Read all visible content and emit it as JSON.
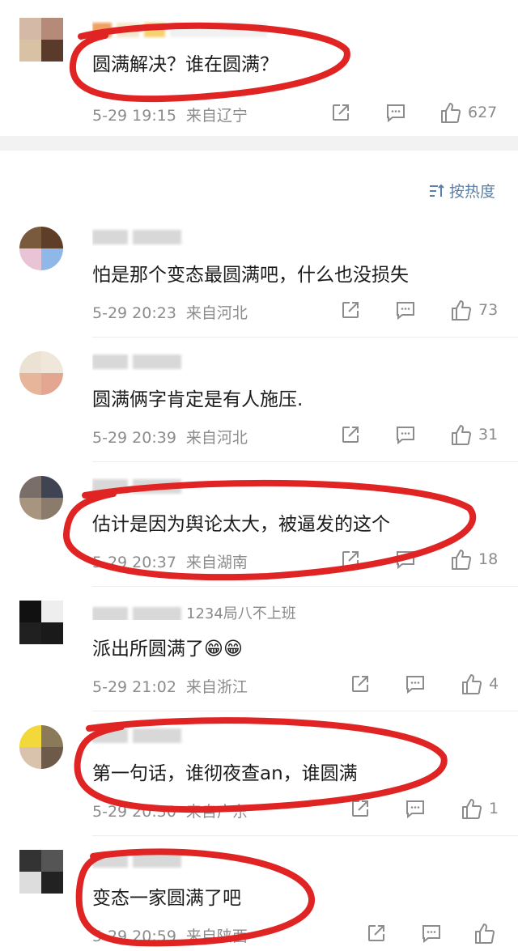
{
  "sort": {
    "label": "按热度"
  },
  "top_comment": {
    "text": "圆满解决？谁在圆满？",
    "date": "5-29 19:15",
    "location": "来自辽宁",
    "likes": "627",
    "avatar_colors": [
      "#d4b9a6",
      "#b58a78",
      "#d9c1a3",
      "#5a3a2a"
    ]
  },
  "comments": [
    {
      "username": "",
      "text": "怕是那个变态最圆满吧，什么也没损失",
      "date": "5-29 20:23",
      "location": "来自河北",
      "likes": "73",
      "avatar_colors": [
        "#7a5a3c",
        "#5e3e26",
        "#e8c4d6",
        "#8fb8e8"
      ]
    },
    {
      "username": "",
      "text": "圆满俩字肯定是有人施压.",
      "date": "5-29 20:39",
      "location": "来自河北",
      "likes": "31",
      "avatar_colors": [
        "#ece2d4",
        "#efe7da",
        "#e6b59a",
        "#e3a690"
      ]
    },
    {
      "username": "",
      "text": "估计是因为舆论太大，被逼发的这个",
      "date": "5-29 20:37",
      "location": "来自湖南",
      "likes": "18",
      "avatar_colors": [
        "#7a6e68",
        "#3f4352",
        "#a8957f",
        "#8a7b6a"
      ]
    },
    {
      "username": "1234局八不上班",
      "text": "派出所圆满了😁😁",
      "date": "5-29 21:02",
      "location": "来自浙江",
      "likes": "4",
      "avatar_colors": [
        "#111111",
        "#eeeeee",
        "#202020",
        "#1a1a1a"
      ]
    },
    {
      "username": "",
      "text": "第一句话，谁彻夜查an，谁圆满",
      "date": "5-29 20:50",
      "location": "来自广东",
      "likes": "1",
      "avatar_colors": [
        "#f2d83a",
        "#8a7a5a",
        "#d9c3ac",
        "#6e5a4a"
      ]
    },
    {
      "username": "",
      "text": "变态一家圆满了吧",
      "date": "5-29 20:59",
      "location": "来自陕西",
      "likes": "",
      "avatar_colors": [
        "#333333",
        "#555555",
        "#dddddd",
        "#222222"
      ]
    }
  ]
}
